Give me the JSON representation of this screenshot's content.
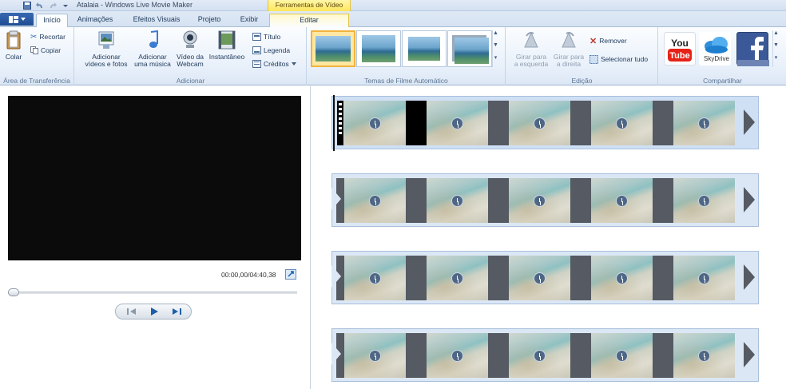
{
  "window": {
    "title": "Atalaia - Windows Live Movie Maker",
    "context_tab_group": "Ferramentas de Vídeo"
  },
  "tabs": [
    {
      "label": "Início",
      "active": true
    },
    {
      "label": "Animações"
    },
    {
      "label": "Efeitos Visuais"
    },
    {
      "label": "Projeto"
    },
    {
      "label": "Exibir"
    },
    {
      "label": "Editar",
      "context": true
    }
  ],
  "ribbon": {
    "clipboard": {
      "label": "Área de Transferência",
      "paste": "Colar",
      "cut": "Recortar",
      "copy": "Copiar"
    },
    "add": {
      "label": "Adicionar",
      "videos_photos": [
        "Adicionar",
        "vídeos e fotos"
      ],
      "music": [
        "Adicionar",
        "uma música"
      ],
      "webcam": [
        "Vídeo da",
        "Webcam"
      ],
      "snapshot": "Instantâneo",
      "title": "Título",
      "caption": "Legenda",
      "credits": "Créditos"
    },
    "themes": {
      "label": "Temas de Filme Automático",
      "count": 4,
      "selected_index": 0
    },
    "editing": {
      "label": "Edição",
      "rotate_left": [
        "Girar para",
        "a esquerda"
      ],
      "rotate_right": [
        "Girar para",
        "a direita"
      ],
      "remove": "Remover",
      "select_all": "Selecionar tudo"
    },
    "share": {
      "label": "Compartilhar",
      "youtube": "You Tube",
      "skydrive": "SkyDrive"
    }
  },
  "preview": {
    "time": "00:00,00/04:40,38",
    "seek_position": 0
  },
  "storyboard": {
    "strips": 4,
    "frames_per_strip": 5
  },
  "colors": {
    "ribbon_text": "#1e395b",
    "selected_theme": "#f1b33d",
    "youtube_red": "#e62117",
    "facebook_blue": "#3b5998"
  }
}
